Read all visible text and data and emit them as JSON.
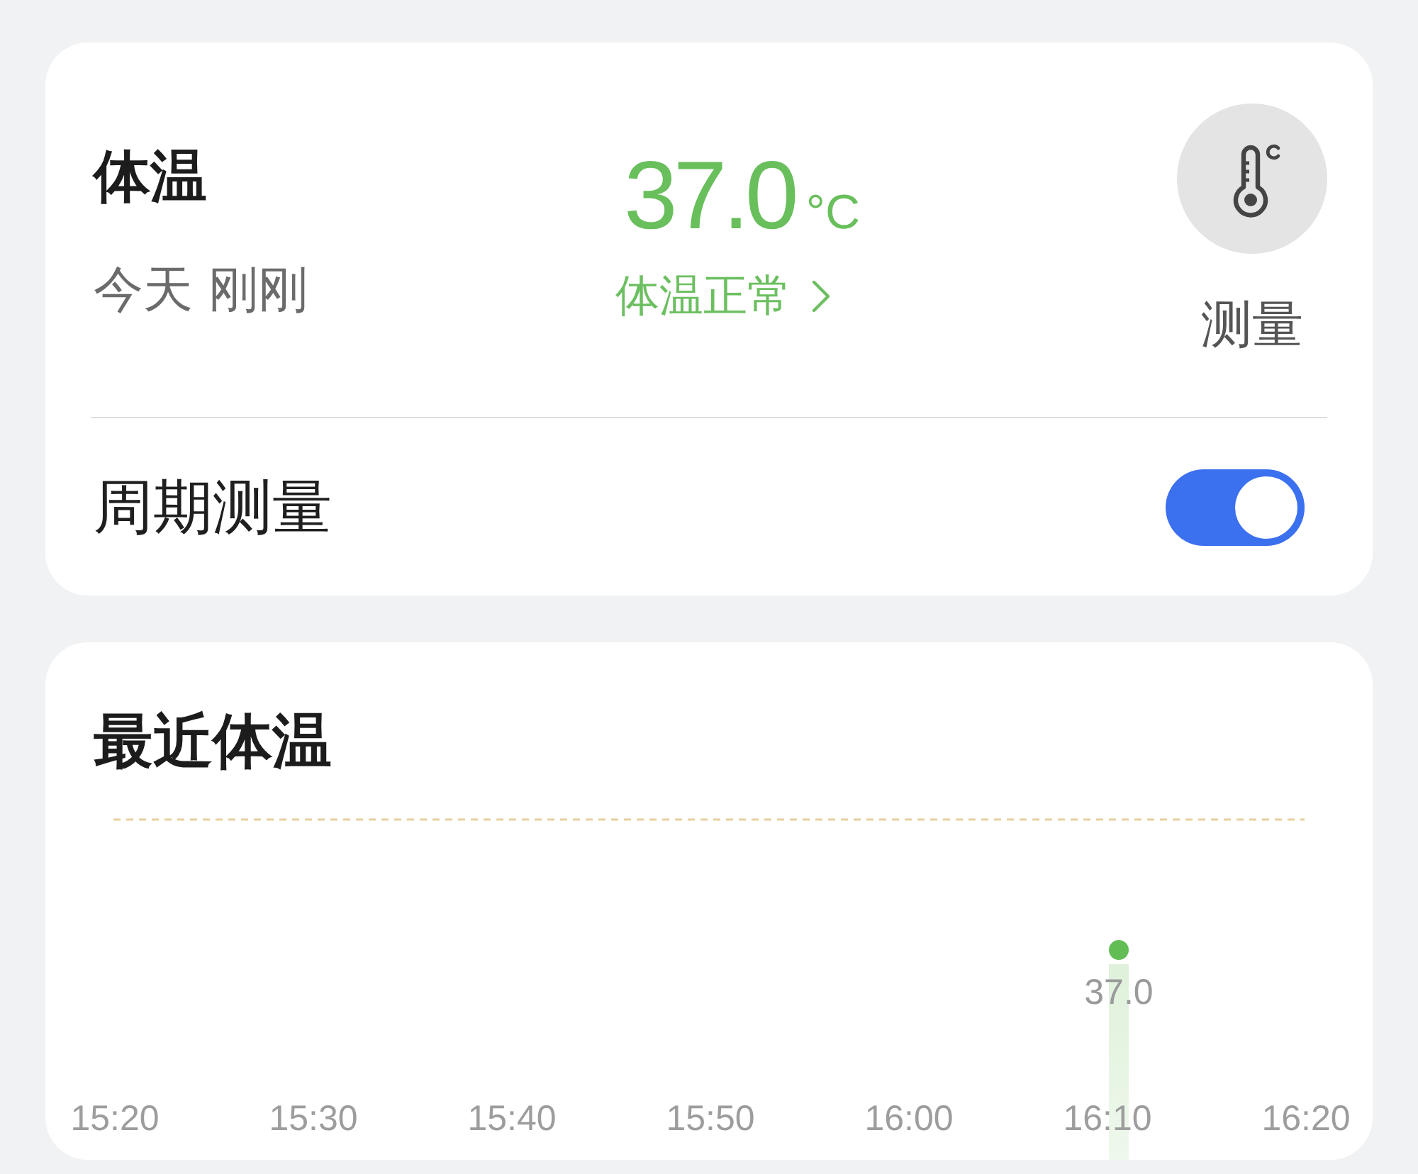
{
  "reading": {
    "title": "体温",
    "time": "今天 刚刚",
    "value": "37.0",
    "unit": "°C",
    "status": "体温正常",
    "measure_label": "测量"
  },
  "periodic": {
    "label": "周期测量",
    "on": true
  },
  "recent": {
    "title": "最近体温",
    "chart_data": {
      "type": "bar",
      "categories": [
        "15:20",
        "15:30",
        "15:40",
        "15:50",
        "16:00",
        "16:10",
        "16:20"
      ],
      "values": [
        null,
        null,
        null,
        null,
        null,
        37.0,
        null
      ],
      "value_labels": [
        null,
        null,
        null,
        null,
        null,
        "37.0",
        null
      ]
    }
  }
}
